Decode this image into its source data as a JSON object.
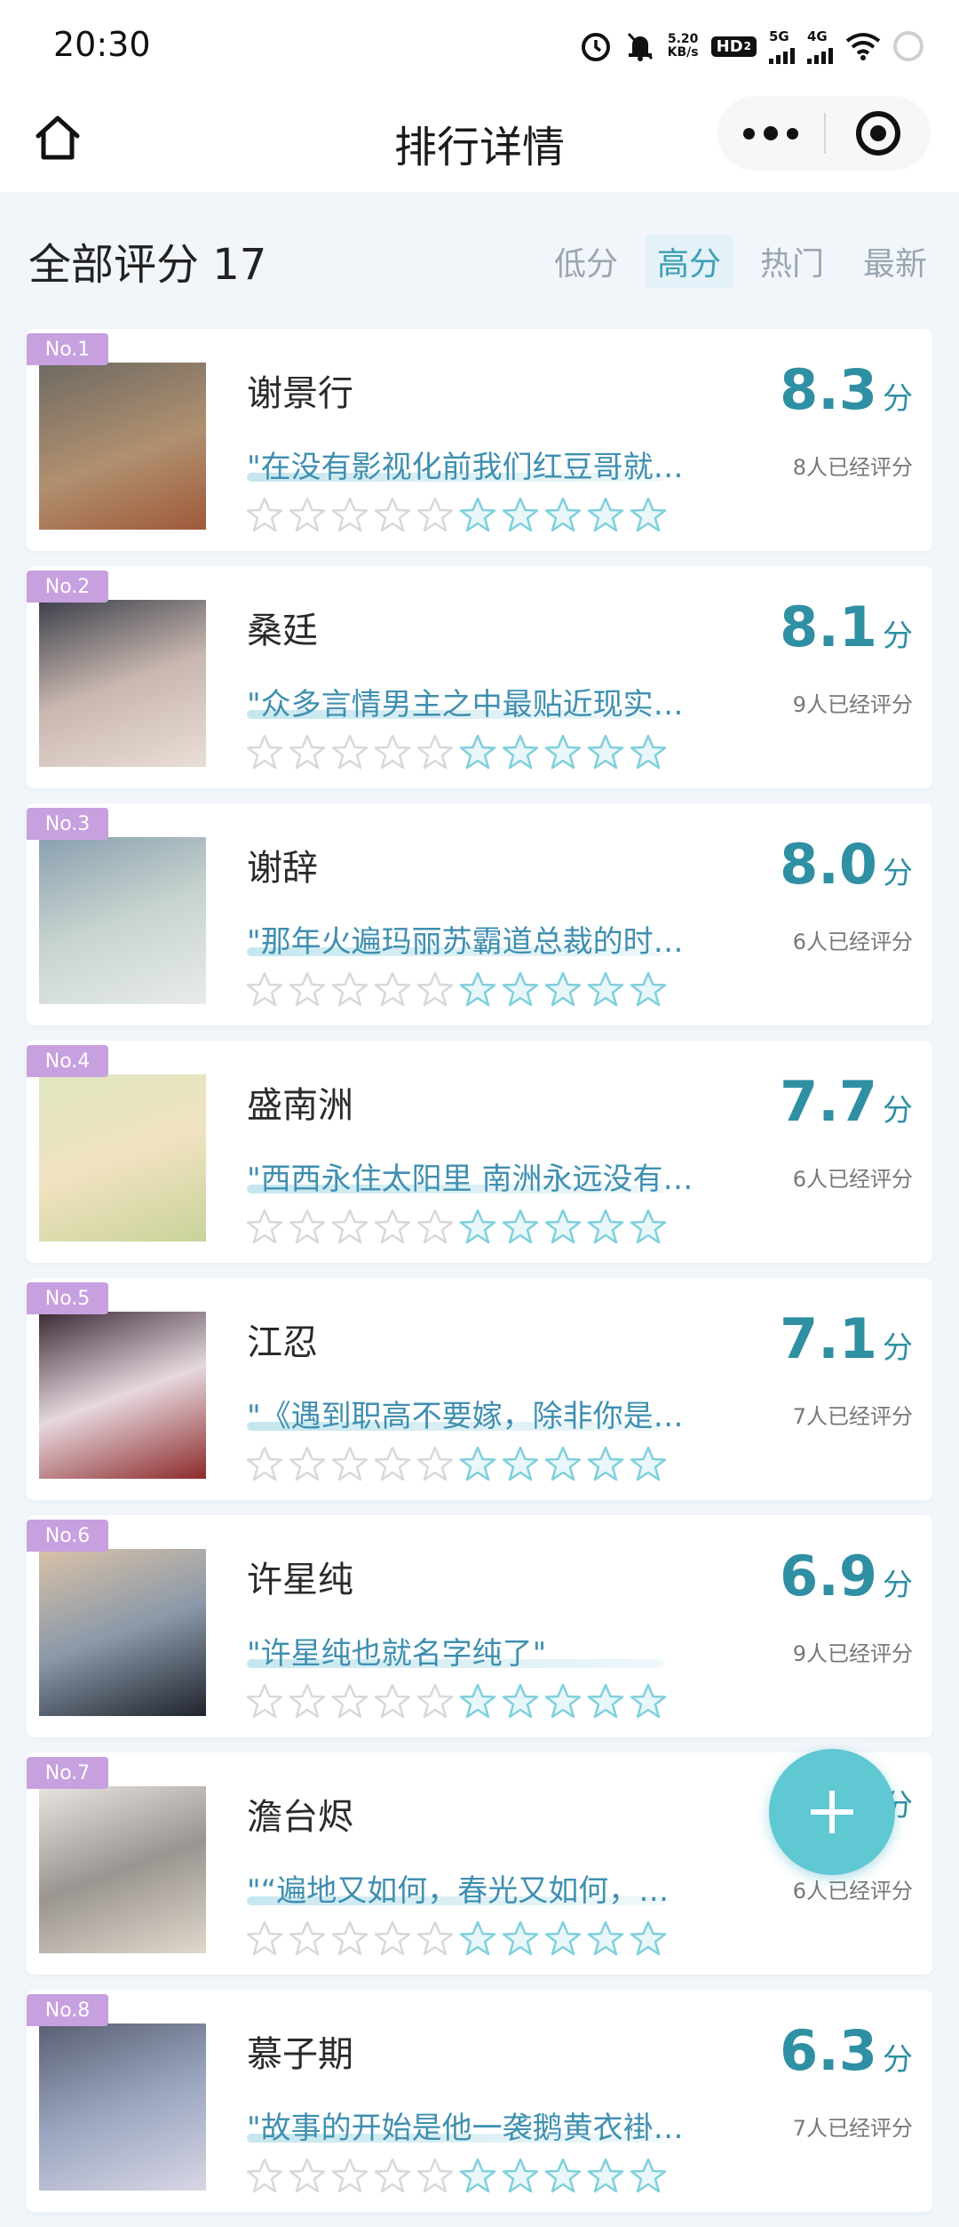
{
  "status_bar": {
    "time": "20:30",
    "net_speed_value": "5.20",
    "net_speed_unit": "KB/s",
    "hd_label": "HD",
    "hd_sub": "2",
    "sig1_label": "5G",
    "sig2_label": "4G",
    "icons": [
      "alarm-icon",
      "mute-bell-icon",
      "hd-icon",
      "signal-5g-icon",
      "signal-4g-icon",
      "wifi-icon",
      "loading-ring-icon"
    ]
  },
  "nav": {
    "title": "排行详情",
    "home_icon": "home-icon",
    "more_icon": "more-dots-icon",
    "close_icon": "target-close-icon"
  },
  "header": {
    "title": "全部评分 17",
    "sort_tabs": [
      {
        "label": "低分",
        "active": false
      },
      {
        "label": "高分",
        "active": true
      },
      {
        "label": "热门",
        "active": false
      },
      {
        "label": "最新",
        "active": false
      }
    ]
  },
  "items": [
    {
      "rank": "No.1",
      "name": "谢景行",
      "quote": "\"在没有影视化前我们红豆哥就…",
      "score": "8.3",
      "unit": "分",
      "raters": "8人已经评分"
    },
    {
      "rank": "No.2",
      "name": "桑廷",
      "quote": "\"众多言情男主之中最贴近现实…",
      "score": "8.1",
      "unit": "分",
      "raters": "9人已经评分"
    },
    {
      "rank": "No.3",
      "name": "谢辞",
      "quote": "\"那年火遍玛丽苏霸道总裁的时…",
      "score": "8.0",
      "unit": "分",
      "raters": "6人已经评分"
    },
    {
      "rank": "No.4",
      "name": "盛南洲",
      "quote": "\"西西永住太阳里 南洲永远没有…",
      "score": "7.7",
      "unit": "分",
      "raters": "6人已经评分"
    },
    {
      "rank": "No.5",
      "name": "江忍",
      "quote": "\"《遇到职高不要嫁，除非你是…",
      "score": "7.1",
      "unit": "分",
      "raters": "7人已经评分"
    },
    {
      "rank": "No.6",
      "name": "许星纯",
      "quote": "\"许星纯也就名字纯了\"",
      "score": "6.9",
      "unit": "分",
      "raters": "9人已经评分"
    },
    {
      "rank": "No.7",
      "name": "澹台烬",
      "quote": "\"“遍地又如何，春光又如何，…",
      "score": "",
      "unit": "分",
      "raters": "6人已经评分"
    },
    {
      "rank": "No.8",
      "name": "慕子期",
      "quote": "\"故事的开始是他一袭鹅黄衣褂…",
      "score": "6.3",
      "unit": "分",
      "raters": "7人已经评分"
    }
  ],
  "fab": {
    "icon": "plus-icon"
  },
  "colors": {
    "accent": "#2f8fa3",
    "badge": "#c7a0df",
    "fab": "#5fc8d3",
    "active_tab_bg": "#e4f1f8"
  }
}
